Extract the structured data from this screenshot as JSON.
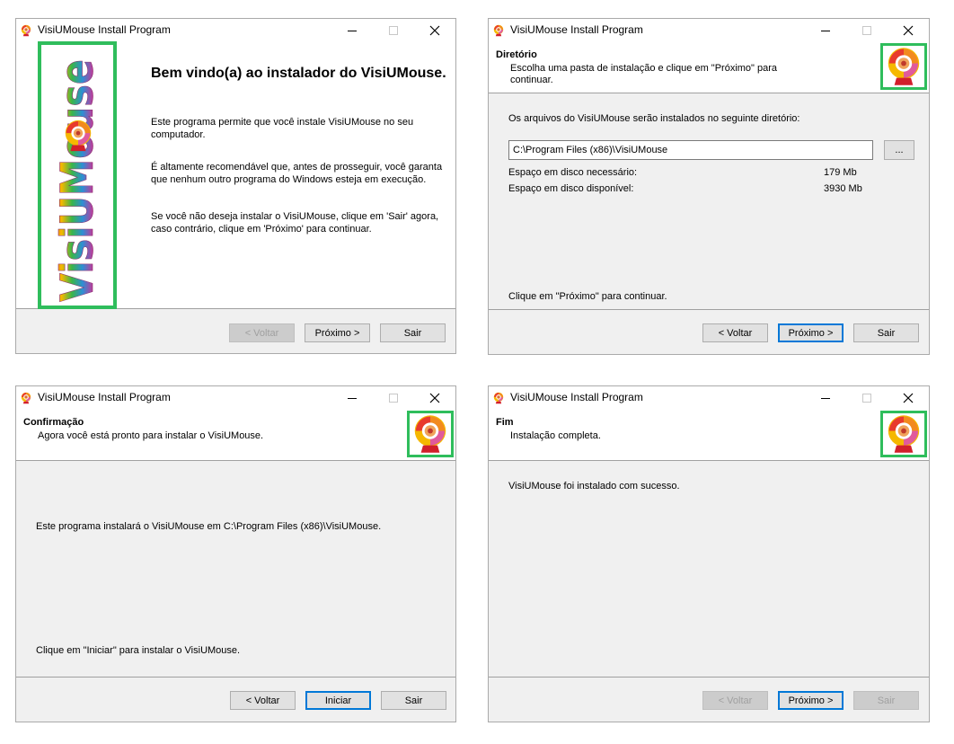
{
  "app": {
    "title": "VisiUMouse Install Program"
  },
  "icons": {
    "app": "webcam-icon",
    "minimize": "minimize-icon",
    "maximize": "maximize-icon",
    "close": "close-icon"
  },
  "colors": {
    "accent": "#2fbd5c",
    "focus": "#0078d7"
  },
  "w1": {
    "banner_text": "VisiUMouse",
    "heading": "Bem vindo(a) ao instalador do VisiUMouse.",
    "p1_line1": "Este programa permite que você instale VisiUMouse no seu",
    "p1_line2": "computador.",
    "p2_line1": "É altamente recomendável que, antes de prosseguir, você garanta",
    "p2_line2": "que nenhum outro programa do Windows esteja em execução.",
    "p3_line1": "Se você não deseja instalar o VisiUMouse, clique em 'Sair' agora,",
    "p3_line2": "caso contrário, clique em 'Próximo' para continuar.",
    "back": "< Voltar",
    "next": "Próximo >",
    "exit": "Sair"
  },
  "w2": {
    "header_title": "Diretório",
    "header_sub": "Escolha uma pasta de instalação e clique em \"Próximo\" para continuar.",
    "intro": "Os arquivos do VisiUMouse serão instalados no seguinte diretório:",
    "path": "C:\\Program Files (x86)\\VisiUMouse",
    "browse": "...",
    "space_required_label": "Espaço em disco necessário:",
    "space_required_value": "179 Mb",
    "space_available_label": "Espaço em disco disponível:",
    "space_available_value": "3930 Mb",
    "footer": "Clique em \"Próximo\" para continuar.",
    "back": "< Voltar",
    "next": "Próximo >",
    "exit": "Sair"
  },
  "w3": {
    "header_title": "Confirmação",
    "header_sub": "Agora você está pronto para instalar o VisiUMouse.",
    "body": "Este programa instalará o VisiUMouse em C:\\Program Files (x86)\\VisiUMouse.",
    "footer": "Clique em \"Iniciar\" para instalar o VisiUMouse.",
    "back": "< Voltar",
    "start": "Iniciar",
    "exit": "Sair"
  },
  "w4": {
    "header_title": "Fim",
    "header_sub": "Instalação completa.",
    "body": "VisiUMouse foi instalado com sucesso.",
    "back": "< Voltar",
    "next": "Próximo >",
    "exit": "Sair"
  }
}
